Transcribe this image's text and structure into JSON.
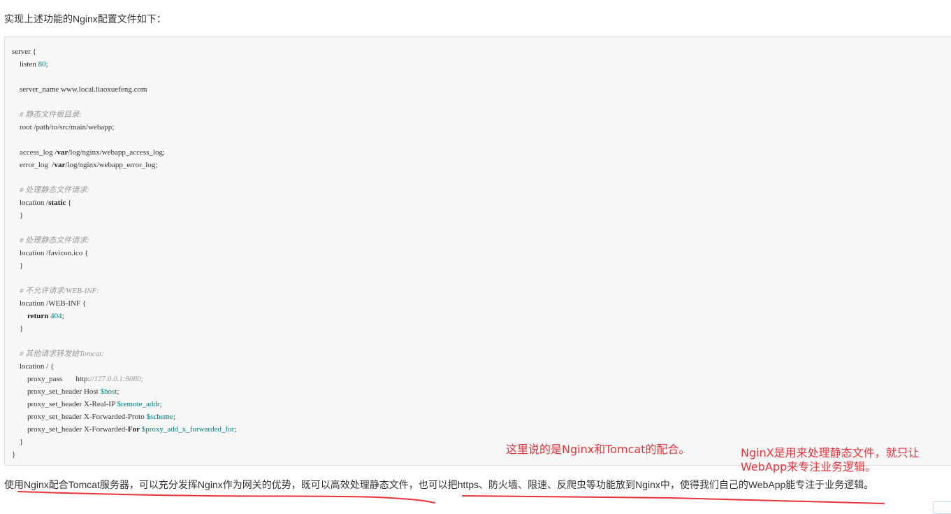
{
  "intro": "实现上述功能的Nginx配置文件如下：",
  "code": [
    [
      {
        "t": "server {"
      }
    ],
    [
      {
        "t": "    listen "
      },
      {
        "t": "80",
        "c": "num"
      },
      {
        "t": ";"
      }
    ],
    [],
    [
      {
        "t": "    server_name www.local.liaoxuefeng.com"
      }
    ],
    [],
    [
      {
        "t": "    # 静态文件根目录:",
        "c": "cm"
      }
    ],
    [
      {
        "t": "    root /path/to/src/main/webapp;"
      }
    ],
    [],
    [
      {
        "t": "    access_log /"
      },
      {
        "t": "var",
        "c": "kw"
      },
      {
        "t": "/log/nginx/webapp_access_log;"
      }
    ],
    [
      {
        "t": "    error_log  /"
      },
      {
        "t": "var",
        "c": "kw"
      },
      {
        "t": "/log/nginx/webapp_error_log;"
      }
    ],
    [],
    [
      {
        "t": "    # 处理静态文件请求:",
        "c": "cm"
      }
    ],
    [
      {
        "t": "    location /"
      },
      {
        "t": "static",
        "c": "kw"
      },
      {
        "t": " {"
      }
    ],
    [
      {
        "t": "    }"
      }
    ],
    [],
    [
      {
        "t": "    # 处理静态文件请求:",
        "c": "cm"
      }
    ],
    [
      {
        "t": "    location /favicon.ico {"
      }
    ],
    [
      {
        "t": "    }"
      }
    ],
    [],
    [
      {
        "t": "    # 不允许请求/WEB-INF:",
        "c": "cm"
      }
    ],
    [
      {
        "t": "    location /WEB-INF {"
      }
    ],
    [
      {
        "t": "        "
      },
      {
        "t": "return",
        "c": "kw"
      },
      {
        "t": " "
      },
      {
        "t": "404",
        "c": "num"
      },
      {
        "t": ";"
      }
    ],
    [
      {
        "t": "    }"
      }
    ],
    [],
    [
      {
        "t": "    # 其他请求转发给Tomcat:",
        "c": "cm"
      }
    ],
    [
      {
        "t": "    location / {"
      }
    ],
    [
      {
        "t": "        proxy_pass       http:"
      },
      {
        "t": "//127.0.0.1:8080;",
        "c": "cm"
      }
    ],
    [
      {
        "t": "        proxy_set_header Host "
      },
      {
        "t": "$host",
        "c": "var"
      },
      {
        "t": ";"
      }
    ],
    [
      {
        "t": "        proxy_set_header X-Real-IP "
      },
      {
        "t": "$remote_addr",
        "c": "var"
      },
      {
        "t": ";"
      }
    ],
    [
      {
        "t": "        proxy_set_header X-Forwarded-Proto "
      },
      {
        "t": "$scheme",
        "c": "var"
      },
      {
        "t": ";"
      }
    ],
    [
      {
        "t": "        proxy_set_header X-Forwarded-"
      },
      {
        "t": "For",
        "c": "kw"
      },
      {
        "t": " "
      },
      {
        "t": "$proxy_add_x_forwarded_for",
        "c": "var"
      },
      {
        "t": ";"
      }
    ],
    [
      {
        "t": "    }"
      }
    ],
    [
      {
        "t": "}"
      }
    ]
  ],
  "annotations": {
    "note1": "这里说的是Nginx和Tomcat的配合。",
    "note2_line1": "NginX是用来处理静态文件，就只让",
    "note2_line2": "WebApp来专注业务逻辑。"
  },
  "summary": "使用Nginx配合Tomcat服务器，可以充分发挥Nginx作为网关的优势，既可以高效处理静态文件，也可以把https、防火墙、限速、反爬虫等功能放到Nginx中，使得我们自己的WebApp能专注于业务逻辑。",
  "colors": {
    "annotation": "#e8333a",
    "code_bg": "#f7f7f7"
  }
}
